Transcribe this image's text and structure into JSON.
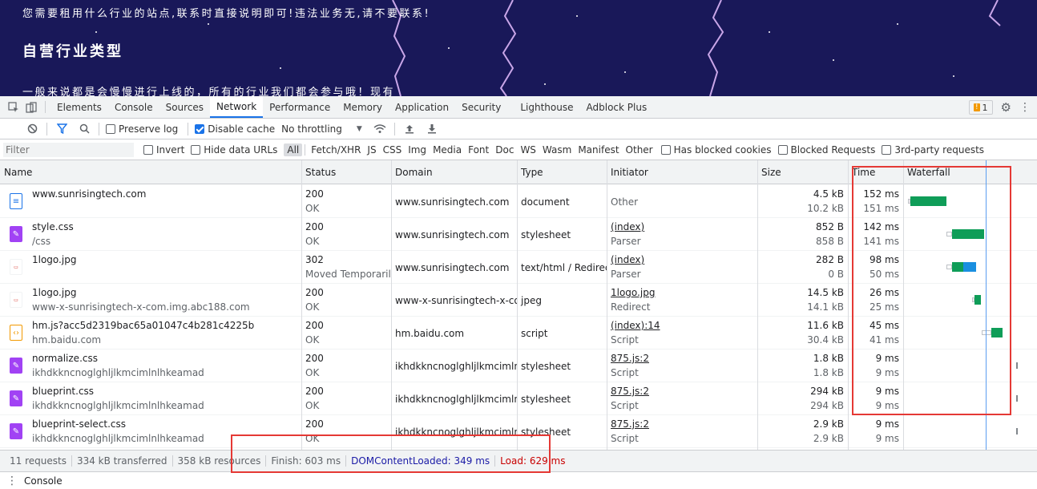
{
  "site": {
    "line1": "您需要租用什么行业的站点,联系时直接说明即可!违法业务无,请不要联系!",
    "heading": "自营行业类型",
    "line2": "一般来说都是会慢慢进行上线的，所有的行业我们都会参与哦！现有"
  },
  "tabs": [
    "Elements",
    "Console",
    "Sources",
    "Network",
    "Performance",
    "Memory",
    "Application",
    "Security",
    "Lighthouse",
    "Adblock Plus"
  ],
  "active_tab": "Network",
  "issues_count": "1",
  "toolbar": {
    "preserve_log": "Preserve log",
    "disable_cache": "Disable cache",
    "throttling": "No throttling"
  },
  "filterbar": {
    "placeholder": "Filter",
    "invert": "Invert",
    "hide_data_urls": "Hide data URLs",
    "types": [
      "All",
      "Fetch/XHR",
      "JS",
      "CSS",
      "Img",
      "Media",
      "Font",
      "Doc",
      "WS",
      "Wasm",
      "Manifest",
      "Other"
    ],
    "has_blocked_cookies": "Has blocked cookies",
    "blocked_requests": "Blocked Requests",
    "third_party": "3rd-party requests"
  },
  "columns": {
    "name": "Name",
    "status": "Status",
    "domain": "Domain",
    "type": "Type",
    "initiator": "Initiator",
    "size": "Size",
    "time": "Time",
    "waterfall": "Waterfall"
  },
  "requests": [
    {
      "icon": "doc",
      "name": "www.sunrisingtech.com",
      "path": "",
      "status": "200",
      "status_text": "OK",
      "domain": "www.sunrisingtech.com",
      "type": "document",
      "initiator": "Other",
      "initiator_sub": "",
      "size": "4.5 kB",
      "resource": "10.2 kB",
      "time": "152 ms",
      "latency": "151 ms"
    },
    {
      "icon": "css",
      "name": "style.css",
      "path": "/css",
      "status": "200",
      "status_text": "OK",
      "domain": "www.sunrisingtech.com",
      "type": "stylesheet",
      "initiator": "(index)",
      "initiator_sub": "Parser",
      "size": "852 B",
      "resource": "858 B",
      "time": "142 ms",
      "latency": "141 ms"
    },
    {
      "icon": "img",
      "name": "1logo.jpg",
      "path": "",
      "status": "302",
      "status_text": "Moved Temporarily",
      "domain": "www.sunrisingtech.com",
      "type": "text/html / Redirect",
      "initiator": "(index)",
      "initiator_sub": "Parser",
      "size": "282 B",
      "resource": "0 B",
      "time": "98 ms",
      "latency": "50 ms"
    },
    {
      "icon": "img",
      "name": "1logo.jpg",
      "path": "www-x-sunrisingtech-x-com.img.abc188.com",
      "status": "200",
      "status_text": "OK",
      "domain": "www-x-sunrisingtech-x-co...",
      "type": "jpeg",
      "initiator": "1logo.jpg",
      "initiator_sub": "Redirect",
      "size": "14.5 kB",
      "resource": "14.1 kB",
      "time": "26 ms",
      "latency": "25 ms"
    },
    {
      "icon": "js",
      "name": "hm.js?acc5d2319bac65a01047c4b281c4225b",
      "path": "hm.baidu.com",
      "status": "200",
      "status_text": "OK",
      "domain": "hm.baidu.com",
      "type": "script",
      "initiator": "(index):14",
      "initiator_sub": "Script",
      "size": "11.6 kB",
      "resource": "30.4 kB",
      "time": "45 ms",
      "latency": "41 ms"
    },
    {
      "icon": "css",
      "name": "normalize.css",
      "path": "ikhdkkncnoglghljlkmcimlnlhkeamad",
      "status": "200",
      "status_text": "OK",
      "domain": "ikhdkkncnoglghljlkmcimln...",
      "type": "stylesheet",
      "initiator": "875.js:2",
      "initiator_sub": "Script",
      "size": "1.8 kB",
      "resource": "1.8 kB",
      "time": "9 ms",
      "latency": "9 ms"
    },
    {
      "icon": "css",
      "name": "blueprint.css",
      "path": "ikhdkkncnoglghljlkmcimlnlhkeamad",
      "status": "200",
      "status_text": "OK",
      "domain": "ikhdkkncnoglghljlkmcimln...",
      "type": "stylesheet",
      "initiator": "875.js:2",
      "initiator_sub": "Script",
      "size": "294 kB",
      "resource": "294 kB",
      "time": "9 ms",
      "latency": "9 ms"
    },
    {
      "icon": "css",
      "name": "blueprint-select.css",
      "path": "ikhdkkncnoglghljlkmcimlnlhkeamad",
      "status": "200",
      "status_text": "OK",
      "domain": "ikhdkkncnoglghljlkmcimln...",
      "type": "stylesheet",
      "initiator": "875.js:2",
      "initiator_sub": "Script",
      "size": "2.9 kB",
      "resource": "2.9 kB",
      "time": "9 ms",
      "latency": "9 ms"
    }
  ],
  "summary": {
    "requests": "11 requests",
    "transferred": "334 kB transferred",
    "resources": "358 kB resources",
    "finish": "Finish: 603 ms",
    "dcl": "DOMContentLoaded: 349 ms",
    "load": "Load: 629 ms"
  },
  "drawer": {
    "tab": "Console"
  },
  "colors": {
    "accent": "#1a73e8",
    "highlight": "#e53935",
    "waterfall_receive": "#0f9d58",
    "waterfall_wait": "#1a8fe0"
  }
}
